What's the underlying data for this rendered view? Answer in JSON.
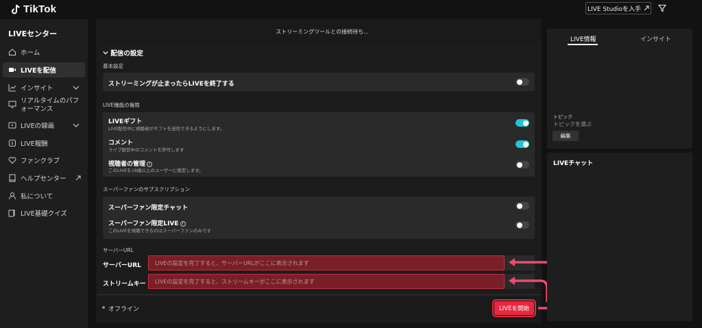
{
  "header": {
    "logo_text": "TikTok",
    "studio_button": "LIVE Studioを入手",
    "colors": {
      "accent": "#e8283f",
      "toggle_on": "#20c5d5"
    }
  },
  "sidebar": {
    "title": "LIVEセンター",
    "items": [
      {
        "label": "ホーム",
        "icon": "home-icon"
      },
      {
        "label": "LIVEを配信",
        "icon": "video-camera-icon",
        "active": true
      },
      {
        "label": "インサイト",
        "icon": "chart-icon",
        "chevron": true
      },
      {
        "label": "リアルタイムのパフォーマンス",
        "icon": "monitor-icon"
      },
      {
        "label": "LIVEの録画",
        "icon": "recording-icon",
        "chevron": true
      },
      {
        "label": "LIVE報酬",
        "icon": "reward-icon"
      },
      {
        "label": "ファンクラブ",
        "icon": "heart-icon"
      },
      {
        "label": "ヘルプセンター",
        "icon": "book-icon",
        "external": true
      },
      {
        "label": "私について",
        "icon": "person-icon"
      },
      {
        "label": "LIVE基礎クイズ",
        "icon": "cards-icon"
      }
    ]
  },
  "main": {
    "connection_status": "ストリーミングツールとの接続待ち...",
    "section_title": "配信の設定",
    "basic_settings": {
      "label": "基本設定",
      "end_on_stop": {
        "label": "ストリーミングが止まったらLIVEを終了する",
        "on": false
      }
    },
    "permissions": {
      "label": "LIVE機能の権限",
      "gifts": {
        "label": "LIVEギフト",
        "desc": "LIVE配信中に視聴者がギフトを送信できるようにします。",
        "on": true
      },
      "comments": {
        "label": "コメント",
        "desc": "ライブ配信中のコメントを許可します",
        "on": true
      },
      "viewer_mgmt": {
        "label": "視聴者の管理",
        "desc": "このLIVEを18歳以上のユーザーに限定します。",
        "on": false
      }
    },
    "superfan": {
      "label": "スーパーファンのサブスクリプション",
      "chat": {
        "label": "スーパーファン限定チャット",
        "on": false
      },
      "live": {
        "label": "スーパーファン限定LIVE",
        "desc": "このLIVEを視聴できるのはスーパーファンのみです",
        "on": false
      }
    },
    "server": {
      "section_label": "サーバーURL",
      "url_label": "サーバーURL",
      "url_placeholder": "LIVEの設定を完了すると、サーバーURLがここに表示されます",
      "key_label": "ストリームキー",
      "key_placeholder": "LIVEの設定を完了すると、ストリームキーがここに表示されます"
    },
    "status": "オフライン",
    "start_button": "LIVEを開始"
  },
  "right": {
    "tabs": [
      "LIVE情報",
      "インサイト"
    ],
    "topic_label": "トピック",
    "topic_value": "トピックを選ぶ",
    "edit_button": "編集",
    "chat_title": "LIVEチャット"
  }
}
